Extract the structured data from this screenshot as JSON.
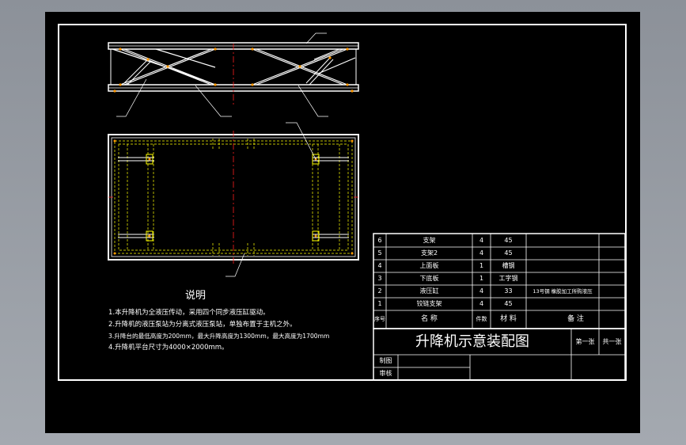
{
  "notes": {
    "heading": "说明",
    "lines": [
      "1.本升降机为全液压传动，采用四个同步液压缸驱动。",
      "2.升降机的液压泵站为分离式液压泵站，单独布置于主机之外。",
      "3.升降台的最低高度为200mm，最大升降高度为1300mm，最大高度为1700mm",
      "4.升降机平台尺寸为4000×2000mm。"
    ]
  },
  "parts_list": {
    "rows": [
      {
        "no": "6",
        "name": "支架",
        "qty": "4",
        "material": "45",
        "remark": ""
      },
      {
        "no": "5",
        "name": "支架2",
        "qty": "4",
        "material": "45",
        "remark": ""
      },
      {
        "no": "4",
        "name": "上面板",
        "qty": "1",
        "material": "槽钢",
        "remark": ""
      },
      {
        "no": "3",
        "name": "下底板",
        "qty": "1",
        "material": "工字钢",
        "remark": ""
      },
      {
        "no": "2",
        "name": "液压缸",
        "qty": "4",
        "material": "33",
        "remark": "13号钢 橡胶加工所购液压"
      },
      {
        "no": "1",
        "name": "铰链支架",
        "qty": "4",
        "material": "45",
        "remark": ""
      }
    ],
    "header": {
      "no": "序号",
      "name": "名  称",
      "qty": "件数",
      "material": "材  料",
      "remark": "备  注"
    }
  },
  "title_block": {
    "title": "升降机示意装配图",
    "sheet_no": "第一张",
    "sheet_total": "共一张",
    "drawn_label": "制图",
    "checked_label": "审核"
  },
  "colors": {
    "background": "#000000",
    "outer_gray": "#9a9fa6",
    "line": "#ffffff",
    "dash": "#ffff00",
    "centerline": "#ff2020",
    "point": "#ff9900"
  }
}
